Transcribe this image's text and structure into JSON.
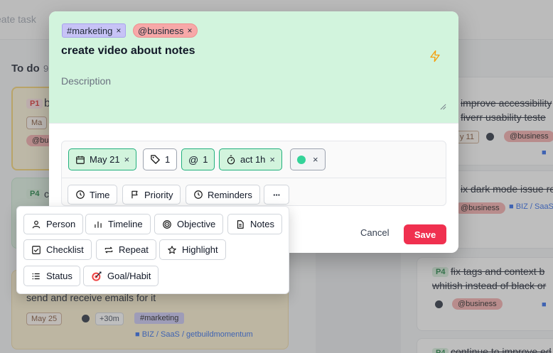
{
  "background": {
    "create_task": "eate task",
    "column_title": "To do",
    "column_count": "9",
    "left_cards": [
      {
        "priority": "P1",
        "text": "b",
        "date": "Ma",
        "tag": "@bus"
      },
      {
        "priority": "P4",
        "text": "c"
      },
      {
        "text": "send and receive emails for it",
        "date": "May 25",
        "estimate": "+30m",
        "tag": "#marketing",
        "path": "BIZ / SaaS / getbuildmomentum"
      }
    ],
    "right_cards": [
      {
        "line1": "improve accessibility",
        "line2": "fiverr usability teste",
        "date": "y 11",
        "tag": "@business"
      },
      {
        "line1": "ix dark mode issue re",
        "tag": "@business",
        "path": "BIZ / SaaS"
      },
      {
        "priority": "P4",
        "line1": "fix tags and context b",
        "line2": "whitish instead of black or",
        "tag": "@business"
      },
      {
        "priority": "P4",
        "line1": "continue to improve ed"
      }
    ]
  },
  "modal": {
    "tags": [
      {
        "label": "#marketing",
        "remove": "×"
      },
      {
        "label": "@business",
        "remove": "×"
      }
    ],
    "title": "create video about notes",
    "description_placeholder": "Description",
    "pills": {
      "date": "May 21",
      "labels_count": "1",
      "contexts_count": "1",
      "context_symbol": "@",
      "actual": "act 1h",
      "remove": "×"
    },
    "secondary": {
      "time": "Time",
      "priority": "Priority",
      "reminders": "Reminders",
      "more": "···"
    },
    "cancel": "Cancel",
    "save": "Save"
  },
  "menu": {
    "person": "Person",
    "timeline": "Timeline",
    "objective": "Objective",
    "notes": "Notes",
    "checklist": "Checklist",
    "repeat": "Repeat",
    "highlight": "Highlight",
    "status": "Status",
    "goal_habit": "Goal/Habit"
  },
  "colors": {
    "modal_top": "#d2f4dd",
    "save": "#f0304f",
    "accent_green": "#22b07d",
    "marketing_tag": "#c7c3f6",
    "business_tag": "#f7a8a8"
  }
}
